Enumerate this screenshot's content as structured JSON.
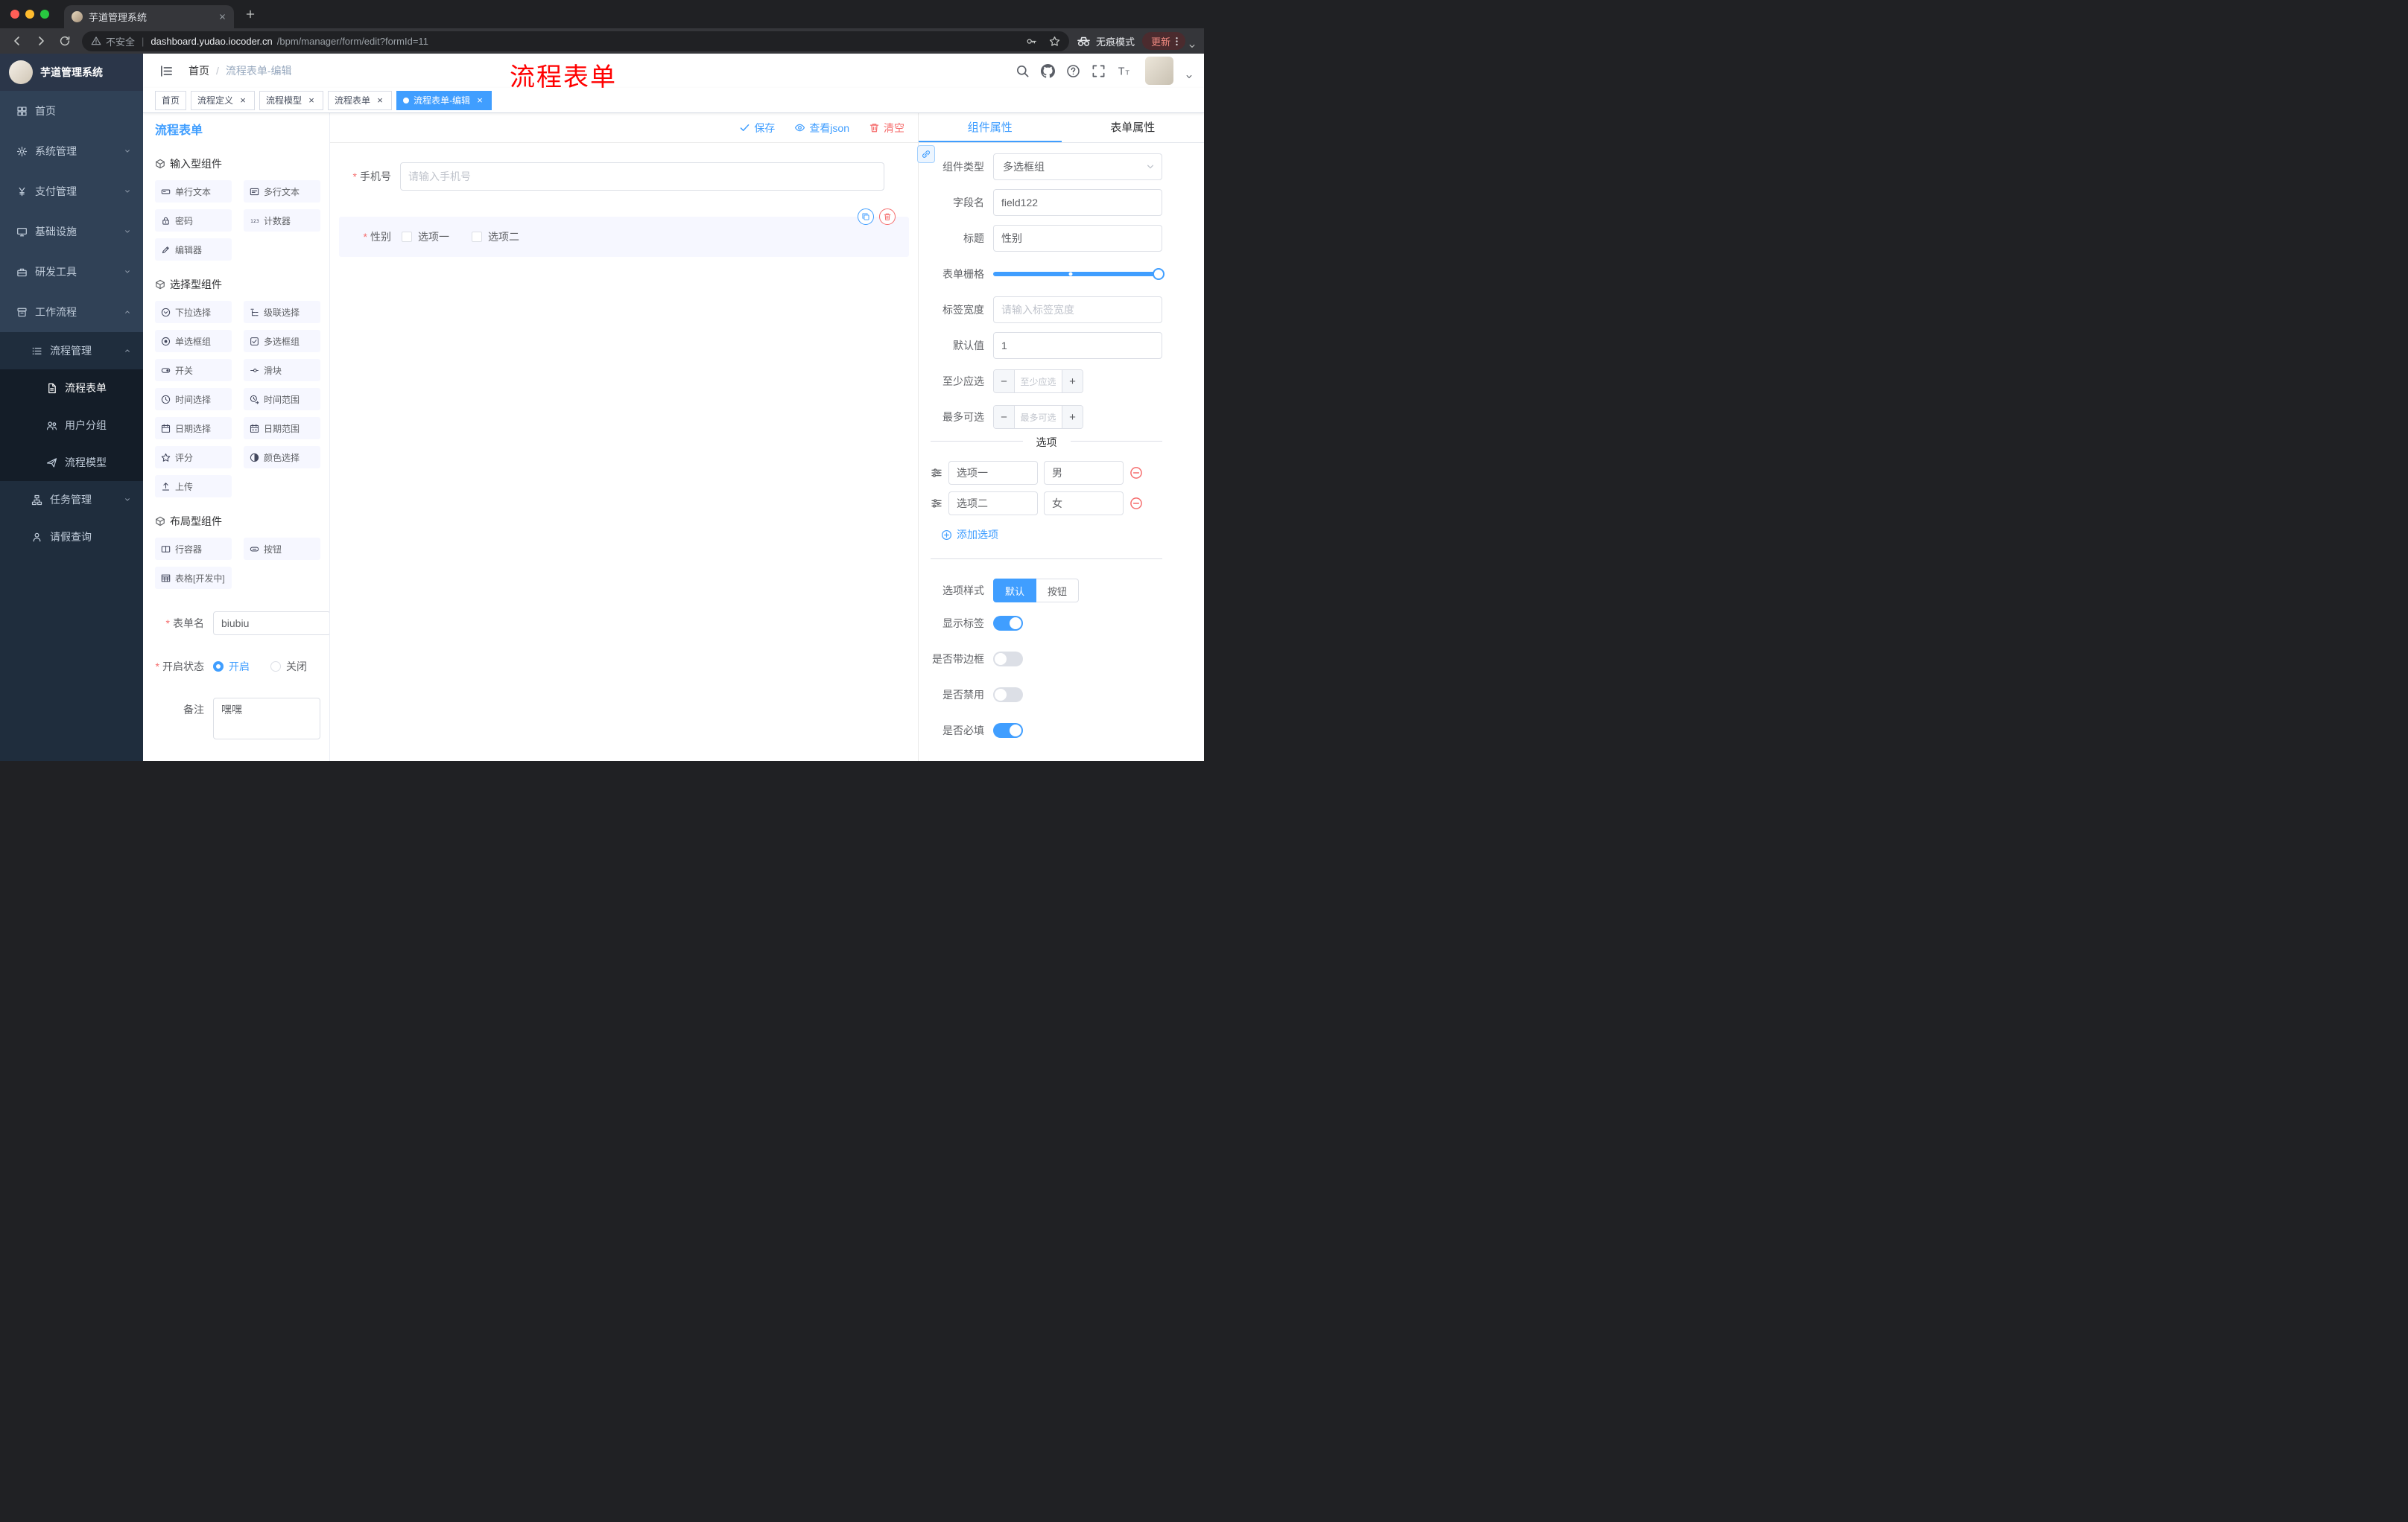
{
  "browser": {
    "tab": {
      "title": "芋道管理系统"
    },
    "address": {
      "security_label": "不安全",
      "host": "dashboard.yudao.iocoder.cn",
      "path": "/bpm/manager/form/edit?formId=11"
    },
    "incognito_label": "无痕模式",
    "update_button": "更新"
  },
  "annotation": {
    "text": "流程表单",
    "color": "#FF0000"
  },
  "sidebar": {
    "app_title": "芋道管理系统",
    "items": [
      {
        "name": "home",
        "label": "首页",
        "icon": "home",
        "level": 1
      },
      {
        "name": "system-mgmt",
        "label": "系统管理",
        "icon": "gear",
        "level": 1,
        "chevron": "down"
      },
      {
        "name": "payment-mgmt",
        "label": "支付管理",
        "icon": "yen",
        "level": 1,
        "chevron": "down"
      },
      {
        "name": "infrastructure",
        "label": "基础设施",
        "icon": "infra",
        "level": 1,
        "chevron": "down"
      },
      {
        "name": "dev-tools",
        "label": "研发工具",
        "icon": "tool",
        "level": 1,
        "chevron": "down"
      },
      {
        "name": "workflow",
        "label": "工作流程",
        "icon": "work",
        "level": 1,
        "chevron": "up"
      },
      {
        "name": "process-mgmt",
        "label": "流程管理",
        "icon": "list",
        "level": 2,
        "chevron": "up"
      },
      {
        "name": "process-form",
        "label": "流程表单",
        "icon": "doc",
        "level": 3,
        "active": true
      },
      {
        "name": "user-group",
        "label": "用户分组",
        "icon": "users",
        "level": 3
      },
      {
        "name": "process-model",
        "label": "流程模型",
        "icon": "plane",
        "level": 3
      },
      {
        "name": "task-mgmt",
        "label": "任务管理",
        "icon": "tree",
        "level": 2,
        "chevron": "down"
      },
      {
        "name": "leave-query",
        "label": "请假查询",
        "icon": "person",
        "level": 2
      }
    ]
  },
  "header": {
    "breadcrumb": [
      "首页",
      "流程表单-编辑"
    ]
  },
  "tags": [
    {
      "label": "首页",
      "closable": false,
      "active": false
    },
    {
      "label": "流程定义",
      "closable": true,
      "active": false
    },
    {
      "label": "流程模型",
      "closable": true,
      "active": false
    },
    {
      "label": "流程表单",
      "closable": true,
      "active": false
    },
    {
      "label": "流程表单-编辑",
      "closable": true,
      "active": true
    }
  ],
  "palette": {
    "title": "流程表单",
    "groups": [
      {
        "title": "输入型组件",
        "items": [
          {
            "label": "单行文本",
            "icon": "input"
          },
          {
            "label": "多行文本",
            "icon": "textarea"
          },
          {
            "label": "密码",
            "icon": "lock"
          },
          {
            "label": "计数器",
            "icon": "number"
          },
          {
            "label": "编辑器",
            "icon": "editor"
          }
        ]
      },
      {
        "title": "选择型组件",
        "items": [
          {
            "label": "下拉选择",
            "icon": "select"
          },
          {
            "label": "级联选择",
            "icon": "cascader"
          },
          {
            "label": "单选框组",
            "icon": "radio"
          },
          {
            "label": "多选框组",
            "icon": "checkbox"
          },
          {
            "label": "开关",
            "icon": "switch"
          },
          {
            "label": "滑块",
            "icon": "sliderh"
          },
          {
            "label": "时间选择",
            "icon": "time"
          },
          {
            "label": "时间范围",
            "icon": "timerange"
          },
          {
            "label": "日期选择",
            "icon": "date"
          },
          {
            "label": "日期范围",
            "icon": "daterange"
          },
          {
            "label": "评分",
            "icon": "rate"
          },
          {
            "label": "颜色选择",
            "icon": "color"
          },
          {
            "label": "上传",
            "icon": "upload"
          }
        ]
      },
      {
        "title": "布局型组件",
        "items": [
          {
            "label": "行容器",
            "icon": "rowc"
          },
          {
            "label": "按钮",
            "icon": "btn"
          },
          {
            "label": "表格[开发中]",
            "icon": "table"
          }
        ]
      }
    ],
    "form": {
      "name_label": "表单名",
      "name_value": "biubiu",
      "status_label": "开启状态",
      "status_on": "开启",
      "status_off": "关闭",
      "remark_label": "备注",
      "remark_value": "嘿嘿"
    }
  },
  "canvas": {
    "actions": {
      "save": "保存",
      "view_json": "查看json",
      "clear": "清空"
    },
    "fields": [
      {
        "label": "手机号",
        "required": true,
        "placeholder": "请输入手机号"
      },
      {
        "label": "性别",
        "required": true,
        "options": [
          "选项一",
          "选项二"
        ]
      }
    ]
  },
  "inspector": {
    "tabs": {
      "component": "组件属性",
      "form": "表单属性"
    },
    "rows": {
      "type_label": "组件类型",
      "type_value": "多选框组",
      "field_label": "字段名",
      "field_value": "field122",
      "title_label": "标题",
      "title_value": "性别",
      "grid_label": "表单栅格",
      "width_label": "标签宽度",
      "width_placeholder": "请输入标签宽度",
      "default_label": "默认值",
      "default_value": "1",
      "min_label": "至少应选",
      "min_placeholder": "至少应选",
      "max_label": "最多可选",
      "max_placeholder": "最多可选"
    },
    "options": {
      "divider": "选项",
      "rows": [
        {
          "label": "选项一",
          "value": "男"
        },
        {
          "label": "选项二",
          "value": "女"
        }
      ],
      "add": "添加选项"
    },
    "style": {
      "label": "选项样式",
      "default_btn": "默认",
      "button_btn": "按钮"
    },
    "switches": [
      {
        "name": "show-label",
        "label": "显示标签",
        "on": true
      },
      {
        "name": "with-border",
        "label": "是否带边框",
        "on": false
      },
      {
        "name": "disabled",
        "label": "是否禁用",
        "on": false
      },
      {
        "name": "required",
        "label": "是否必填",
        "on": true
      }
    ]
  },
  "colors": {
    "primary": "#409EFF",
    "danger": "#F56C6C",
    "annotation_red": "#FF0000",
    "sidebar_bg": "#304156",
    "sidebar_sub_bg": "#1F2D3D"
  }
}
